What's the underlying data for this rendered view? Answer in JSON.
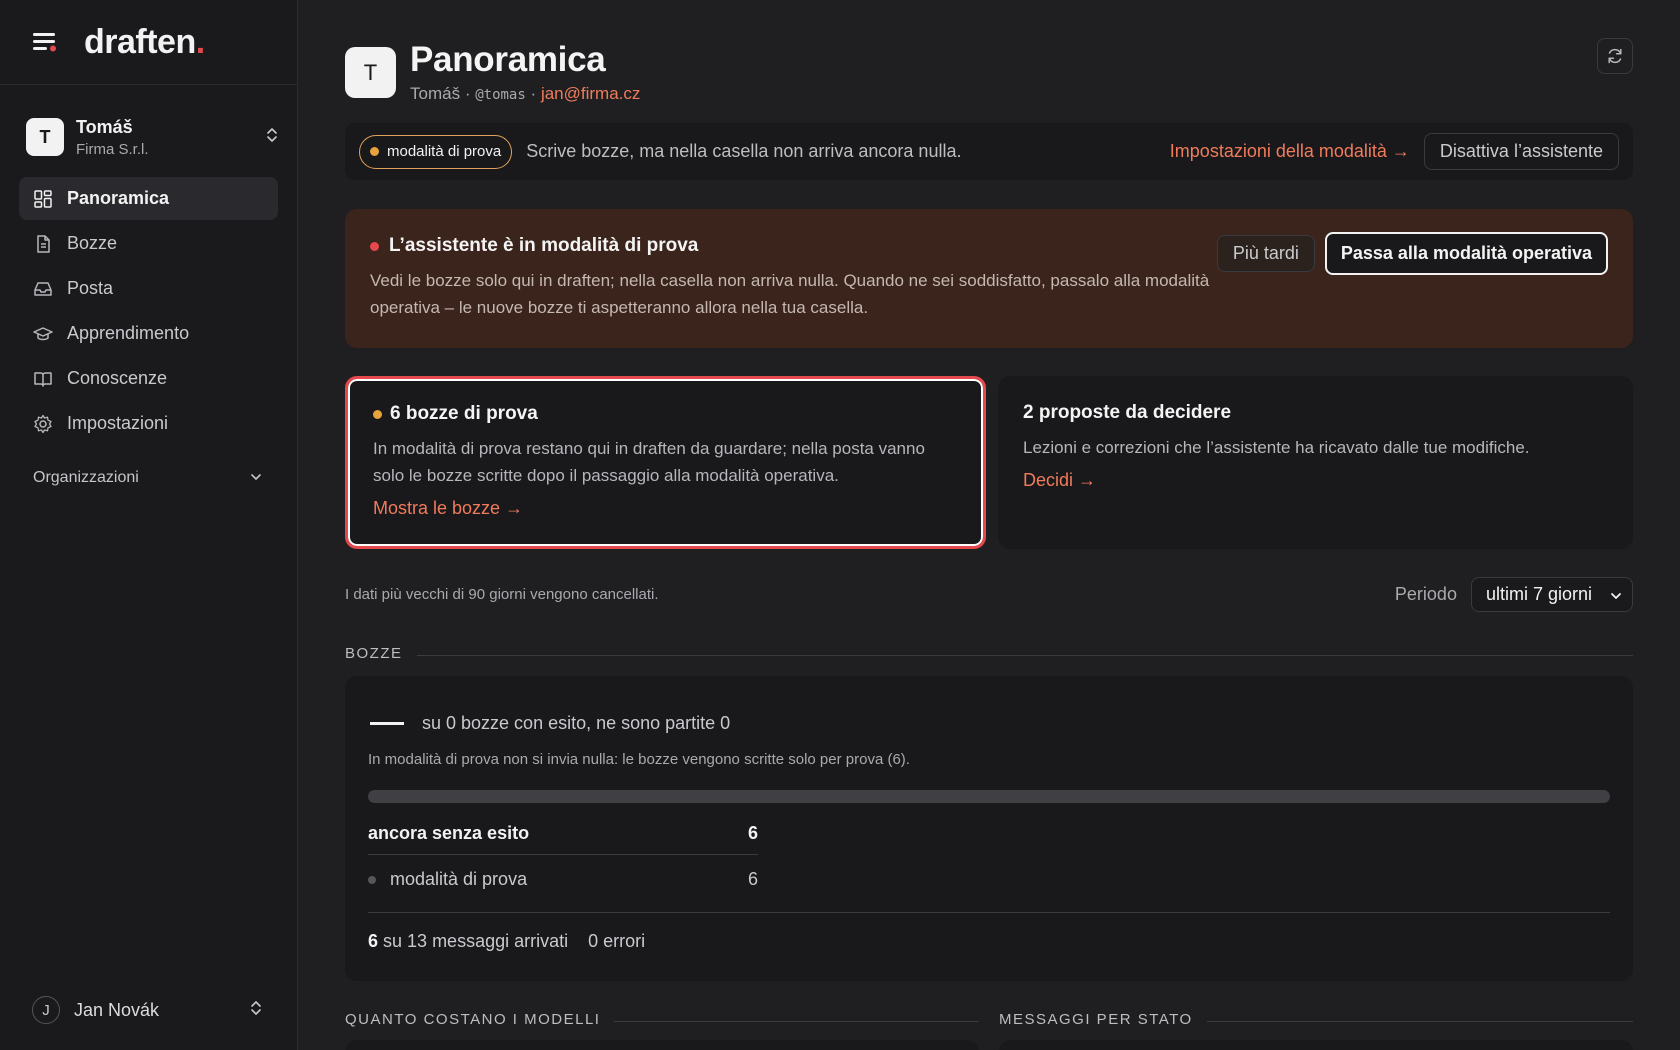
{
  "brand": {
    "name": "draften",
    "dot": "."
  },
  "account": {
    "initial": "T",
    "name": "Tomáš",
    "org": "Firma S.r.l."
  },
  "nav": [
    {
      "label": "Panoramica",
      "icon": "dashboard-icon",
      "active": true
    },
    {
      "label": "Bozze",
      "icon": "document-icon"
    },
    {
      "label": "Posta",
      "icon": "inbox-icon"
    },
    {
      "label": "Apprendimento",
      "icon": "graduation-cap-icon"
    },
    {
      "label": "Conoscenze",
      "icon": "book-icon"
    },
    {
      "label": "Impostazioni",
      "icon": "gear-icon"
    }
  ],
  "organizations_label": "Organizzazioni",
  "user": {
    "initial": "J",
    "name": "Jan Novák"
  },
  "header": {
    "initial": "T",
    "title": "Panoramica",
    "name": "Tomáš",
    "sep": "·",
    "handle": "@tomas",
    "email": "jan@firma.cz"
  },
  "mode_bar": {
    "pill": "modalità di prova",
    "description": "Scrive bozze, ma nella casella non arriva ancora nulla.",
    "settings_link": "Impostazioni della modalità →",
    "disable_button": "Disattiva l’assistente"
  },
  "alert": {
    "title": "L’assistente è in modalità di prova",
    "text": "Vedi le bozze solo qui in draften; nella casella non arriva nulla. Quando ne sei soddisfatto, passalo alla modalità operativa – le nuove bozze ti aspetteranno allora nella tua casella.",
    "later_button": "Più tardi",
    "primary_button": "Passa alla modalità operativa"
  },
  "cards": {
    "drafts": {
      "title": "6 bozze di prova",
      "text": "In modalità di prova restano qui in draften da guardare; nella posta vanno solo le bozze scritte dopo il passaggio alla modalità operativa.",
      "link": "Mostra le bozze →"
    },
    "proposals": {
      "title": "2 proposte da decidere",
      "text": "Lezioni e correzioni che l’assistente ha ricavato dalle tue modifiche.",
      "link": "Decidi →"
    }
  },
  "retention": "I dati più vecchi di 90 giorni vengono cancellati.",
  "period": {
    "label": "Periodo",
    "selected": "ultimi 7 giorni"
  },
  "drafts_section": {
    "label": "BOZZE",
    "stat": "su 0 bozze con esito, ne sono partite 0",
    "note": "In modalità di prova non si invia nulla: le bozze vengono scritte solo per prova (6).",
    "progress": 0,
    "rows": {
      "head": {
        "label": "ancora senza esito",
        "value": "6"
      },
      "sub": {
        "label": "modalità di prova",
        "value": "6"
      }
    },
    "footer": {
      "arrived_num": "6",
      "arrived_text": "su 13 messaggi arrivati",
      "errors": "0 errori"
    }
  },
  "bottom_sections": {
    "left": "QUANTO COSTANO I MODELLI",
    "right": "MESSAGGI PER STATO"
  },
  "colors": {
    "accent": "#f07b5a",
    "danger": "#e5484d",
    "amber": "#e8a33d",
    "background": "#1f1f22",
    "sidebar": "#1a1a1d"
  }
}
